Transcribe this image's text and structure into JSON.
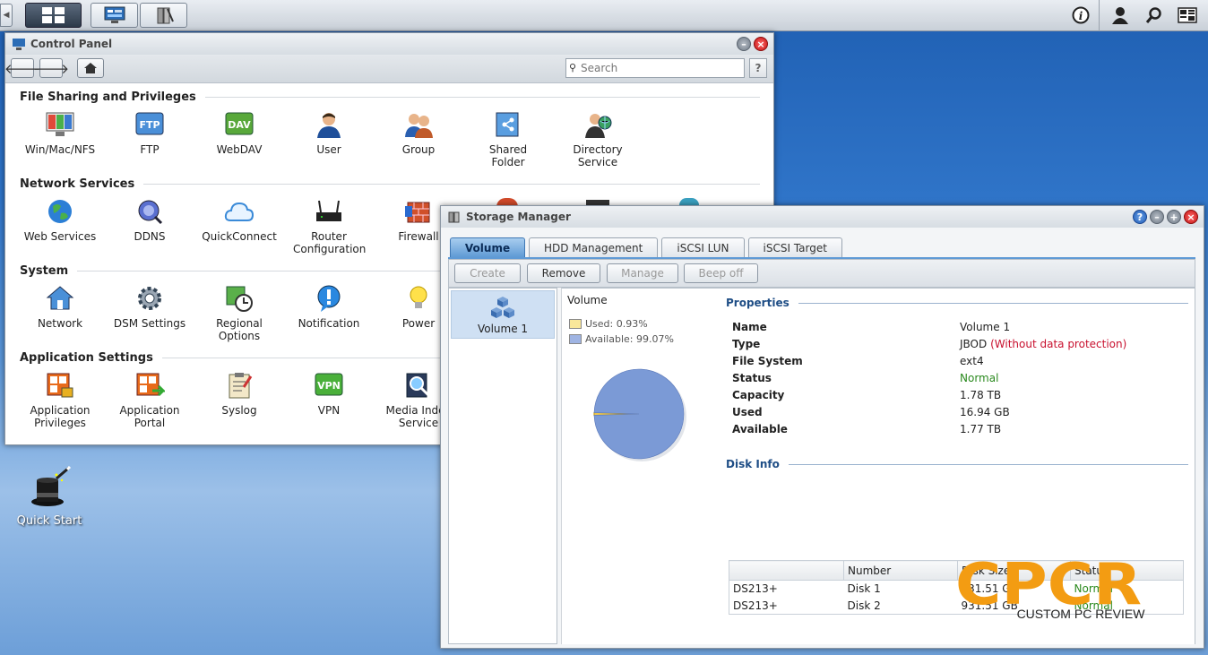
{
  "desktop": {
    "quick_start_label": "Quick Start"
  },
  "control_panel": {
    "title": "Control Panel",
    "search_placeholder": "Search",
    "help_label": "?",
    "sections": [
      {
        "title": "File Sharing and Privileges",
        "items": [
          "Win/Mac/NFS",
          "FTP",
          "WebDAV",
          "User",
          "Group",
          "Shared Folder",
          "Directory Service"
        ]
      },
      {
        "title": "Network Services",
        "items": [
          "Web Services",
          "DDNS",
          "QuickConnect",
          "Router Configuration",
          "Firewall"
        ]
      },
      {
        "title": "System",
        "items": [
          "Network",
          "DSM Settings",
          "Regional Options",
          "Notification",
          "Power"
        ]
      },
      {
        "title": "Application Settings",
        "items": [
          "Application Privileges",
          "Application Portal",
          "Syslog",
          "VPN",
          "Media Index Service"
        ]
      }
    ],
    "icon_badges": {
      "ftp": "FTP",
      "dav": "DAV",
      "vpn": "VPN"
    }
  },
  "storage_manager": {
    "title": "Storage Manager",
    "tabs": [
      "Volume",
      "HDD Management",
      "iSCSI LUN",
      "iSCSI Target"
    ],
    "actions": [
      "Create",
      "Remove",
      "Manage",
      "Beep off"
    ],
    "volume_list": [
      "Volume 1"
    ],
    "chart_heading": "Volume",
    "legend": {
      "used": "Used: 0.93%",
      "available": "Available: 99.07%"
    },
    "properties_heading": "Properties",
    "properties": {
      "name_k": "Name",
      "name_v": "Volume 1",
      "type_k": "Type",
      "type_v": "JBOD",
      "type_note": "(Without data protection)",
      "fs_k": "File System",
      "fs_v": "ext4",
      "status_k": "Status",
      "status_v": "Normal",
      "capacity_k": "Capacity",
      "capacity_v": "1.78 TB",
      "used_k": "Used",
      "used_v": "16.94 GB",
      "available_k": "Available",
      "available_v": "1.77 TB"
    },
    "disk_info_heading": "Disk Info",
    "disk_headers": [
      "",
      "Number",
      "Disk Size",
      "Status"
    ],
    "disks": [
      {
        "model": "DS213+",
        "number": "Disk 1",
        "size": "931.51 GB",
        "status": "Normal"
      },
      {
        "model": "DS213+",
        "number": "Disk 2",
        "size": "931.51 GB",
        "status": "Normal"
      }
    ]
  },
  "chart_data": {
    "type": "pie",
    "labels": [
      "Used",
      "Available"
    ],
    "values": [
      0.93,
      99.07
    ],
    "colors": [
      "#f3d060",
      "#7b9ad6"
    ]
  },
  "watermark": {
    "brand": "CPCR",
    "tagline": "CUSTOM PC REVIEW"
  },
  "colors": {
    "accent": "#5f9ad5",
    "status_ok": "#2b8a1f",
    "warning": "#c8102e",
    "logo": "#f39c12"
  }
}
